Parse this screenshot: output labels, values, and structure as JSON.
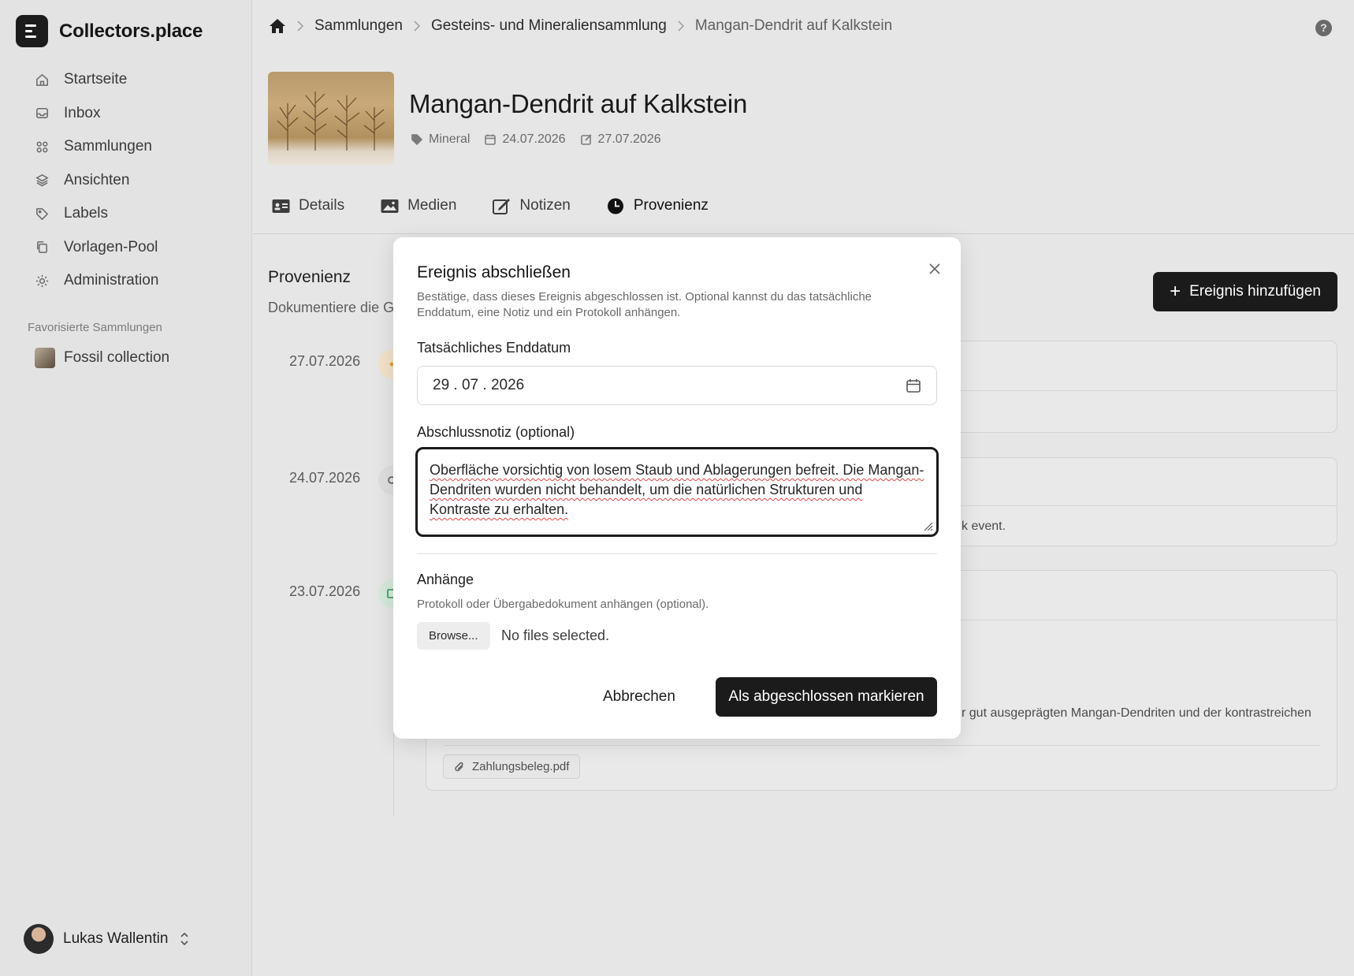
{
  "app": {
    "name": "Collectors.place"
  },
  "sidebar": {
    "items": [
      {
        "label": "Startseite",
        "icon": "home-icon"
      },
      {
        "label": "Inbox",
        "icon": "inbox-icon"
      },
      {
        "label": "Sammlungen",
        "icon": "grid-icon"
      },
      {
        "label": "Ansichten",
        "icon": "layers-icon"
      },
      {
        "label": "Labels",
        "icon": "tag-icon"
      },
      {
        "label": "Vorlagen-Pool",
        "icon": "copy-icon"
      },
      {
        "label": "Administration",
        "icon": "gear-icon"
      }
    ],
    "favorites_heading": "Favorisierte Sammlungen",
    "favorites": [
      {
        "label": "Fossil collection"
      }
    ],
    "user": {
      "name": "Lukas Wallentin"
    }
  },
  "breadcrumb": {
    "items": [
      "Sammlungen",
      "Gesteins- und Mineraliensammlung",
      "Mangan-Dendrit auf Kalkstein"
    ]
  },
  "item": {
    "title": "Mangan-Dendrit auf Kalkstein",
    "category": "Mineral",
    "created": "24.07.2026",
    "modified": "27.07.2026"
  },
  "tabs": [
    {
      "label": "Details",
      "icon": "id-card-icon"
    },
    {
      "label": "Medien",
      "icon": "image-icon"
    },
    {
      "label": "Notizen",
      "icon": "edit-icon"
    },
    {
      "label": "Provenienz",
      "icon": "clock-icon",
      "active": true
    }
  ],
  "provenance": {
    "title": "Provenienz",
    "description": "Dokumentiere die G",
    "add_button": "Ereignis hinzufügen",
    "events": [
      {
        "date": "27.07.2026"
      },
      {
        "date": "24.07.2026",
        "visible_text": "k event."
      },
      {
        "date": "23.07.2026",
        "visible_text": "r gut ausgeprägten Mangan-Dendriten und der kontrastreichen",
        "attachment": "Zahlungsbeleg.pdf"
      }
    ]
  },
  "modal": {
    "title": "Ereignis abschließen",
    "description": "Bestätige, dass dieses Ereignis abgeschlossen ist. Optional kannst du das tatsächliche Enddatum, eine Notiz und ein Protokoll anhängen.",
    "date_label": "Tatsächliches Enddatum",
    "date_value": "29 . 07 . 2026",
    "note_label": "Abschlussnotiz (optional)",
    "note_value": "Oberfläche vorsichtig von losem Staub und Ablagerungen befreit. Die Mangan-Dendriten wurden nicht behandelt, um die natürlichen Strukturen und Kontraste zu erhalten.",
    "attachments_label": "Anhänge",
    "attachments_hint": "Protokoll oder Übergabedokument anhängen (optional).",
    "browse_label": "Browse...",
    "no_files": "No files selected.",
    "cancel_label": "Abbrechen",
    "confirm_label": "Als abgeschlossen markieren"
  },
  "colors": {
    "primary_button": "#1b1b1b",
    "background": "#e6e6e6",
    "modal": "#ffffff"
  }
}
